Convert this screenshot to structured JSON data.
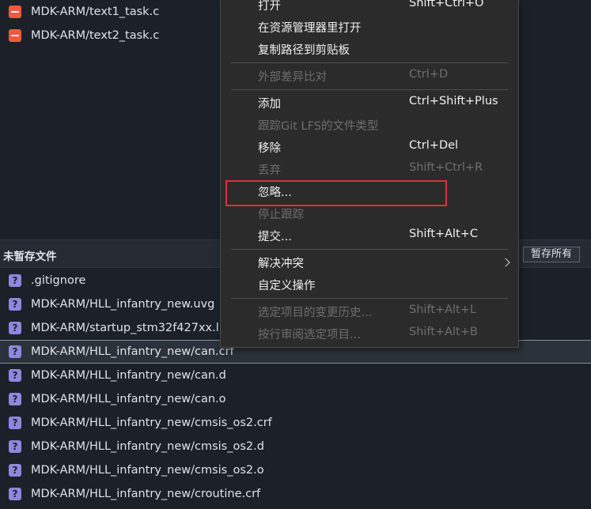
{
  "staged": [
    {
      "path": "MDK-ARM/text1_task.c"
    },
    {
      "path": "MDK-ARM/text2_task.c"
    }
  ],
  "unstaged_header": {
    "title": "未暂存文件",
    "stash_all_label": "暂存所有"
  },
  "unstaged": [
    {
      "path": ".gitignore"
    },
    {
      "path": "MDK-ARM/HLL_infantry_new.uvg"
    },
    {
      "path": "MDK-ARM/startup_stm32f427xx.l"
    },
    {
      "path": "MDK-ARM/HLL_infantry_new/can.crf"
    },
    {
      "path": "MDK-ARM/HLL_infantry_new/can.d"
    },
    {
      "path": "MDK-ARM/HLL_infantry_new/can.o"
    },
    {
      "path": "MDK-ARM/HLL_infantry_new/cmsis_os2.crf"
    },
    {
      "path": "MDK-ARM/HLL_infantry_new/cmsis_os2.d"
    },
    {
      "path": "MDK-ARM/HLL_infantry_new/cmsis_os2.o"
    },
    {
      "path": "MDK-ARM/HLL_infantry_new/croutine.crf"
    }
  ],
  "status_icon_glyph": "?",
  "context_menu": {
    "items": [
      {
        "label": "打开",
        "shortcut": "Shift+Ctrl+O"
      },
      {
        "label": "在资源管理器里打开",
        "shortcut": ""
      },
      {
        "label": "复制路径到剪贴板",
        "shortcut": ""
      },
      {
        "label": "外部差异比对",
        "shortcut": "Ctrl+D"
      },
      {
        "label": "添加",
        "shortcut": "Ctrl+Shift+Plus"
      },
      {
        "label": "跟踪Git LFS的文件类型",
        "shortcut": ""
      },
      {
        "label": "移除",
        "shortcut": "Ctrl+Del"
      },
      {
        "label": "丢弃",
        "shortcut": "Shift+Ctrl+R"
      },
      {
        "label": "忽略...",
        "shortcut": ""
      },
      {
        "label": "停止跟踪",
        "shortcut": ""
      },
      {
        "label": "提交...",
        "shortcut": "Shift+Alt+C"
      },
      {
        "label": "解决冲突",
        "shortcut": ""
      },
      {
        "label": "自定义操作",
        "shortcut": ""
      },
      {
        "label": "选定项目的变更历史...",
        "shortcut": "Shift+Alt+L"
      },
      {
        "label": "按行审阅选定项目...",
        "shortcut": "Shift+Alt+B"
      }
    ]
  },
  "colors": {
    "modified_icon": "#f05a3c",
    "untracked_icon": "#8f86dd",
    "highlight_box": "#d8323a"
  }
}
